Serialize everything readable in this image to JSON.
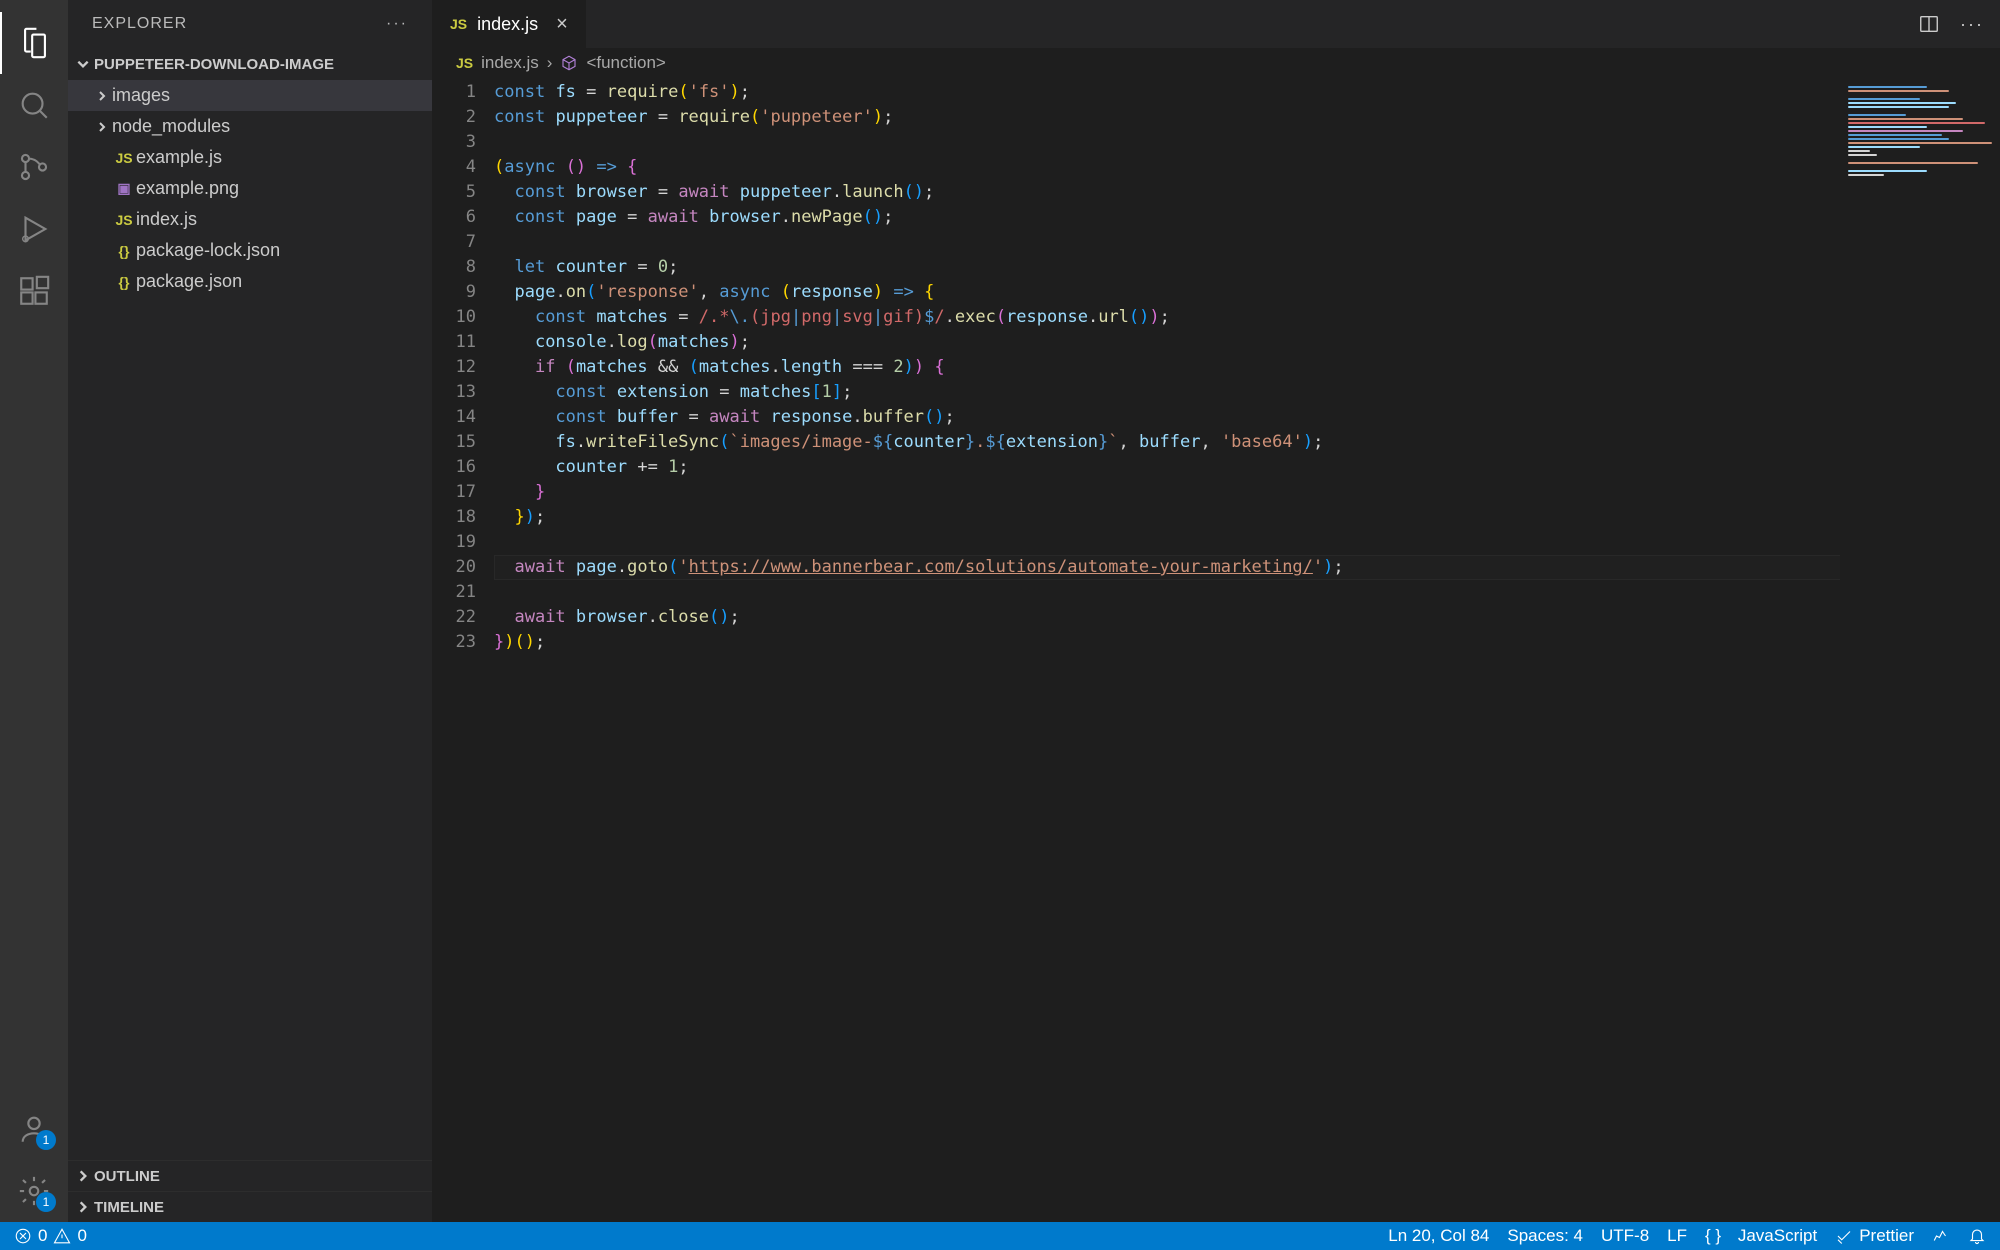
{
  "activity": {
    "account_badge": "1"
  },
  "sidebar": {
    "header": "EXPLORER",
    "project": "PUPPETEER-DOWNLOAD-IMAGE",
    "items": [
      {
        "name": "images",
        "type": "folder"
      },
      {
        "name": "node_modules",
        "type": "folder"
      },
      {
        "name": "example.js",
        "type": "js"
      },
      {
        "name": "example.png",
        "type": "img"
      },
      {
        "name": "index.js",
        "type": "js"
      },
      {
        "name": "package-lock.json",
        "type": "json"
      },
      {
        "name": "package.json",
        "type": "json"
      }
    ],
    "outline": "OUTLINE",
    "timeline": "TIMELINE"
  },
  "tabs": {
    "active": "index.js"
  },
  "breadcrumb": {
    "file": "index.js",
    "symbol": "<function>"
  },
  "code": {
    "url": "https://www.bannerbear.com/solutions/automate-your-marketing/",
    "line_count": 23,
    "highlighted_line": 20
  },
  "status": {
    "errors": "0",
    "warnings": "0",
    "ln_col": "Ln 20, Col 84",
    "spaces": "Spaces: 4",
    "encoding": "UTF-8",
    "eol": "LF",
    "language": "JavaScript",
    "formatter": "Prettier"
  }
}
